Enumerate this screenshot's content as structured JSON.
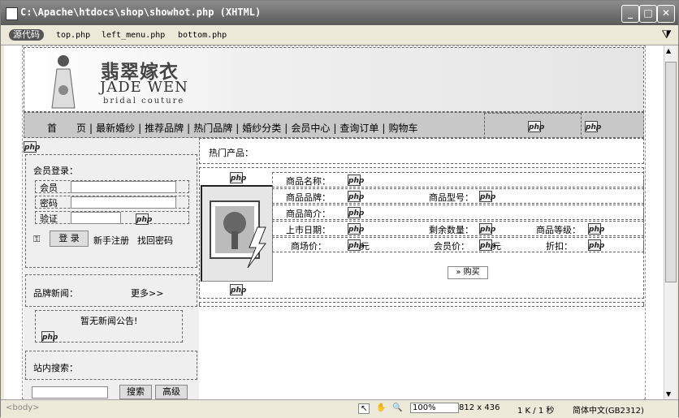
{
  "window": {
    "title": "C:\\Apache\\htdocs\\shop\\showhot.php (XHTML)",
    "min_icon": "minimize-icon",
    "max_icon": "maximize-icon",
    "close_icon": "close-icon"
  },
  "toolbar": {
    "source_label": "源代码",
    "files": [
      "top.php",
      "left_menu.php",
      "bottom.php"
    ]
  },
  "header": {
    "logo_cn": "翡翠嫁衣",
    "logo_en": "JADE WEN",
    "logo_sub": "bridal couture"
  },
  "nav": {
    "items": [
      "首　　页",
      "最新婚纱",
      "推荐品牌",
      "热门品牌",
      "婚纱分类",
      "会员中心",
      "查询订单",
      "购物车"
    ]
  },
  "php_label": "php",
  "sidebar": {
    "login_title": "会员登录：",
    "member_label": "会员",
    "password_label": "密码",
    "verify_label": "验证",
    "login_button": "登 录",
    "register_link": "新手注册",
    "recover_link": "找回密码",
    "brand_news_title": "品牌新闻：",
    "more_link": "更多>>",
    "no_news": "暂无新闻公告!",
    "search_title": "站内搜索：",
    "search_button": "搜索",
    "advanced_button": "高级"
  },
  "main": {
    "hot_title": "热门产品：",
    "name_label": "商品名称：",
    "brand_label": "商品品牌：",
    "model_label": "商品型号：",
    "intro_label": "商品简介：",
    "date_label": "上市日期：",
    "stock_label": "剩余数量：",
    "grade_label": "商品等级：",
    "market_price_label": "商场价：",
    "member_price_label": "会员价：",
    "discount_label": "折扣：",
    "yuan": "元",
    "buy_button": "» 购买"
  },
  "status": {
    "tag": "<body>",
    "zoom": "100%",
    "size": "812 x 436",
    "weight": "1 K / 1 秒",
    "encoding": "简体中文(GB2312)"
  }
}
